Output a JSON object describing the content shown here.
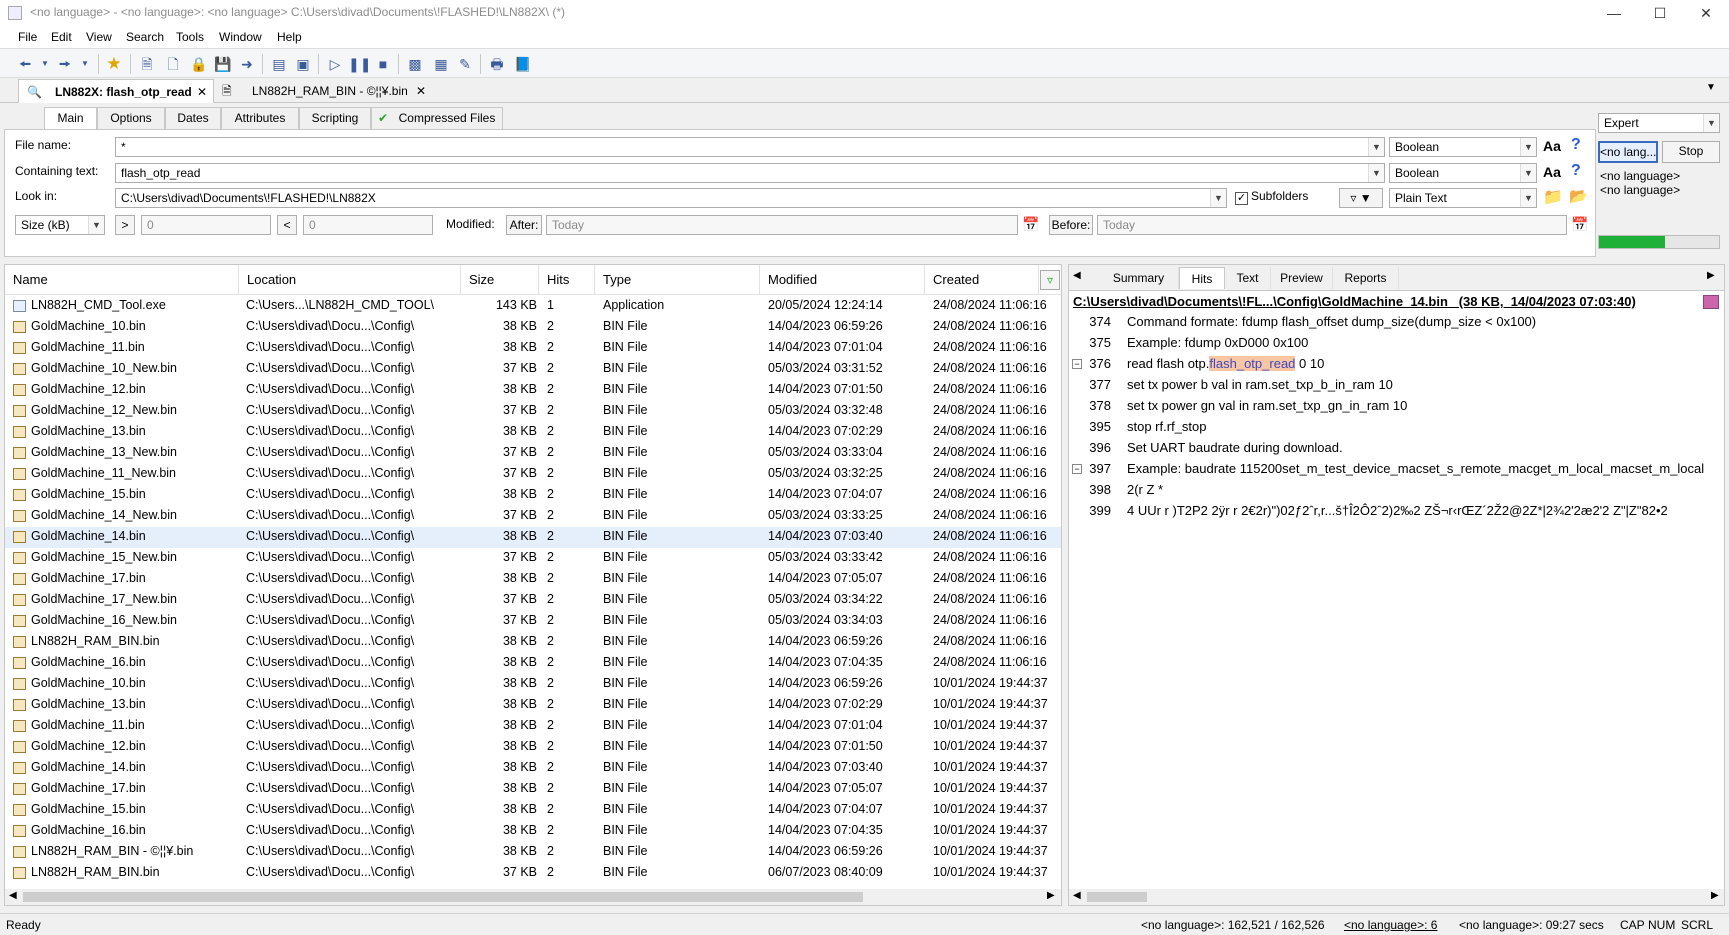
{
  "window": {
    "title": "<no language> - <no language>: <no language> C:\\Users\\divad\\Documents\\!FLASHED!\\LN882X\\ (*)"
  },
  "menu": [
    "File",
    "Edit",
    "View",
    "Search",
    "Tools",
    "Window",
    "Help"
  ],
  "doc_tabs": [
    {
      "label": "LN882X: flash_otp_read"
    },
    {
      "label": "LN882H_RAM_BIN - ©¦¦¥.bin"
    }
  ],
  "criteria_tabs": [
    "Main",
    "Options",
    "Dates",
    "Attributes",
    "Scripting",
    "Compressed Files"
  ],
  "criteria": {
    "file_name_label": "File name:",
    "file_name_value": "*",
    "file_name_mode": "Boolean",
    "containing_label": "Containing text:",
    "containing_value": "flash_otp_read",
    "containing_mode": "Boolean",
    "look_in_label": "Look in:",
    "look_in_value": "C:\\Users\\divad\\Documents\\!FLASHED!\\LN882X",
    "subfolders_label": "Subfolders",
    "text_type": "Plain Text",
    "size_unit": "Size (kB)",
    "gt_label": ">",
    "gt_value": "0",
    "lt_label": "<",
    "lt_value": "0",
    "modified_label": "Modified:",
    "after_label": "After:",
    "after_value": "Today",
    "before_label": "Before:",
    "before_value": "Today",
    "aa_label": "Aa",
    "help_label": "?"
  },
  "side_controls": {
    "mode": "Expert",
    "lang_button": "<no lang...",
    "stop_button": "Stop",
    "lang_line1": "<no language>",
    "lang_line2": "<no language>",
    "progress": 0.55
  },
  "list": {
    "columns": [
      "Name",
      "Location",
      "Size",
      "Hits",
      "Type",
      "Modified",
      "Created"
    ],
    "rows": [
      {
        "name": "LN882H_CMD_Tool.exe",
        "loc": "C:\\Users...\\LN882H_CMD_TOOL\\",
        "size": "143 KB",
        "hits": "1",
        "type": "Application",
        "mod": "20/05/2024 12:24:14",
        "cre": "24/08/2024 11:06:16"
      },
      {
        "name": "GoldMachine_10.bin",
        "loc": "C:\\Users\\divad\\Docu...\\Config\\",
        "size": "38 KB",
        "hits": "2",
        "type": "BIN File",
        "mod": "14/04/2023 06:59:26",
        "cre": "24/08/2024 11:06:16"
      },
      {
        "name": "GoldMachine_11.bin",
        "loc": "C:\\Users\\divad\\Docu...\\Config\\",
        "size": "38 KB",
        "hits": "2",
        "type": "BIN File",
        "mod": "14/04/2023 07:01:04",
        "cre": "24/08/2024 11:06:16"
      },
      {
        "name": "GoldMachine_10_New.bin",
        "loc": "C:\\Users\\divad\\Docu...\\Config\\",
        "size": "37 KB",
        "hits": "2",
        "type": "BIN File",
        "mod": "05/03/2024 03:31:52",
        "cre": "24/08/2024 11:06:16"
      },
      {
        "name": "GoldMachine_12.bin",
        "loc": "C:\\Users\\divad\\Docu...\\Config\\",
        "size": "38 KB",
        "hits": "2",
        "type": "BIN File",
        "mod": "14/04/2023 07:01:50",
        "cre": "24/08/2024 11:06:16"
      },
      {
        "name": "GoldMachine_12_New.bin",
        "loc": "C:\\Users\\divad\\Docu...\\Config\\",
        "size": "37 KB",
        "hits": "2",
        "type": "BIN File",
        "mod": "05/03/2024 03:32:48",
        "cre": "24/08/2024 11:06:16"
      },
      {
        "name": "GoldMachine_13.bin",
        "loc": "C:\\Users\\divad\\Docu...\\Config\\",
        "size": "38 KB",
        "hits": "2",
        "type": "BIN File",
        "mod": "14/04/2023 07:02:29",
        "cre": "24/08/2024 11:06:16"
      },
      {
        "name": "GoldMachine_13_New.bin",
        "loc": "C:\\Users\\divad\\Docu...\\Config\\",
        "size": "37 KB",
        "hits": "2",
        "type": "BIN File",
        "mod": "05/03/2024 03:33:04",
        "cre": "24/08/2024 11:06:16"
      },
      {
        "name": "GoldMachine_11_New.bin",
        "loc": "C:\\Users\\divad\\Docu...\\Config\\",
        "size": "37 KB",
        "hits": "2",
        "type": "BIN File",
        "mod": "05/03/2024 03:32:25",
        "cre": "24/08/2024 11:06:16"
      },
      {
        "name": "GoldMachine_15.bin",
        "loc": "C:\\Users\\divad\\Docu...\\Config\\",
        "size": "38 KB",
        "hits": "2",
        "type": "BIN File",
        "mod": "14/04/2023 07:04:07",
        "cre": "24/08/2024 11:06:16"
      },
      {
        "name": "GoldMachine_14_New.bin",
        "loc": "C:\\Users\\divad\\Docu...\\Config\\",
        "size": "37 KB",
        "hits": "2",
        "type": "BIN File",
        "mod": "05/03/2024 03:33:25",
        "cre": "24/08/2024 11:06:16"
      },
      {
        "name": "GoldMachine_14.bin",
        "loc": "C:\\Users\\divad\\Docu...\\Config\\",
        "size": "38 KB",
        "hits": "2",
        "type": "BIN File",
        "mod": "14/04/2023 07:03:40",
        "cre": "24/08/2024 11:06:16"
      },
      {
        "name": "GoldMachine_15_New.bin",
        "loc": "C:\\Users\\divad\\Docu...\\Config\\",
        "size": "37 KB",
        "hits": "2",
        "type": "BIN File",
        "mod": "05/03/2024 03:33:42",
        "cre": "24/08/2024 11:06:16"
      },
      {
        "name": "GoldMachine_17.bin",
        "loc": "C:\\Users\\divad\\Docu...\\Config\\",
        "size": "38 KB",
        "hits": "2",
        "type": "BIN File",
        "mod": "14/04/2023 07:05:07",
        "cre": "24/08/2024 11:06:16"
      },
      {
        "name": "GoldMachine_17_New.bin",
        "loc": "C:\\Users\\divad\\Docu...\\Config\\",
        "size": "37 KB",
        "hits": "2",
        "type": "BIN File",
        "mod": "05/03/2024 03:34:22",
        "cre": "24/08/2024 11:06:16"
      },
      {
        "name": "GoldMachine_16_New.bin",
        "loc": "C:\\Users\\divad\\Docu...\\Config\\",
        "size": "37 KB",
        "hits": "2",
        "type": "BIN File",
        "mod": "05/03/2024 03:34:03",
        "cre": "24/08/2024 11:06:16"
      },
      {
        "name": "LN882H_RAM_BIN.bin",
        "loc": "C:\\Users\\divad\\Docu...\\Config\\",
        "size": "38 KB",
        "hits": "2",
        "type": "BIN File",
        "mod": "14/04/2023 06:59:26",
        "cre": "24/08/2024 11:06:16"
      },
      {
        "name": "GoldMachine_16.bin",
        "loc": "C:\\Users\\divad\\Docu...\\Config\\",
        "size": "38 KB",
        "hits": "2",
        "type": "BIN File",
        "mod": "14/04/2023 07:04:35",
        "cre": "24/08/2024 11:06:16"
      },
      {
        "name": "GoldMachine_10.bin",
        "loc": "C:\\Users\\divad\\Docu...\\Config\\",
        "size": "38 KB",
        "hits": "2",
        "type": "BIN File",
        "mod": "14/04/2023 06:59:26",
        "cre": "10/01/2024 19:44:37"
      },
      {
        "name": "GoldMachine_13.bin",
        "loc": "C:\\Users\\divad\\Docu...\\Config\\",
        "size": "38 KB",
        "hits": "2",
        "type": "BIN File",
        "mod": "14/04/2023 07:02:29",
        "cre": "10/01/2024 19:44:37"
      },
      {
        "name": "GoldMachine_11.bin",
        "loc": "C:\\Users\\divad\\Docu...\\Config\\",
        "size": "38 KB",
        "hits": "2",
        "type": "BIN File",
        "mod": "14/04/2023 07:01:04",
        "cre": "10/01/2024 19:44:37"
      },
      {
        "name": "GoldMachine_12.bin",
        "loc": "C:\\Users\\divad\\Docu...\\Config\\",
        "size": "38 KB",
        "hits": "2",
        "type": "BIN File",
        "mod": "14/04/2023 07:01:50",
        "cre": "10/01/2024 19:44:37"
      },
      {
        "name": "GoldMachine_14.bin",
        "loc": "C:\\Users\\divad\\Docu...\\Config\\",
        "size": "38 KB",
        "hits": "2",
        "type": "BIN File",
        "mod": "14/04/2023 07:03:40",
        "cre": "10/01/2024 19:44:37"
      },
      {
        "name": "GoldMachine_17.bin",
        "loc": "C:\\Users\\divad\\Docu...\\Config\\",
        "size": "38 KB",
        "hits": "2",
        "type": "BIN File",
        "mod": "14/04/2023 07:05:07",
        "cre": "10/01/2024 19:44:37"
      },
      {
        "name": "GoldMachine_15.bin",
        "loc": "C:\\Users\\divad\\Docu...\\Config\\",
        "size": "38 KB",
        "hits": "2",
        "type": "BIN File",
        "mod": "14/04/2023 07:04:07",
        "cre": "10/01/2024 19:44:37"
      },
      {
        "name": "GoldMachine_16.bin",
        "loc": "C:\\Users\\divad\\Docu...\\Config\\",
        "size": "38 KB",
        "hits": "2",
        "type": "BIN File",
        "mod": "14/04/2023 07:04:35",
        "cre": "10/01/2024 19:44:37"
      },
      {
        "name": "LN882H_RAM_BIN - ©¦¦¥.bin",
        "loc": "C:\\Users\\divad\\Docu...\\Config\\",
        "size": "38 KB",
        "hits": "2",
        "type": "BIN File",
        "mod": "14/04/2023 06:59:26",
        "cre": "10/01/2024 19:44:37"
      },
      {
        "name": "LN882H_RAM_BIN.bin",
        "loc": "C:\\Users\\divad\\Docu...\\Config\\",
        "size": "37 KB",
        "hits": "2",
        "type": "BIN File",
        "mod": "06/07/2023 08:40:09",
        "cre": "10/01/2024 19:44:37"
      }
    ]
  },
  "right": {
    "tabs": [
      "Summary",
      "Hits",
      "Text",
      "Preview",
      "Reports"
    ],
    "active_tab": "Hits",
    "file_header": "C:\\Users\\divad\\Documents\\!FL...\\Config\\GoldMachine_14.bin   (38 KB,  14/04/2023 07:03:40)",
    "hits": [
      {
        "num": "374",
        "text": "Command formate: fdump flash_offset dump_size(dump_size < 0x100)"
      },
      {
        "num": "375",
        "text": " Example: fdump 0xD000 0x100"
      },
      {
        "num": "376",
        "pre": "read flash otp.",
        "hl": "flash_otp_read",
        "post": " 0 10"
      },
      {
        "num": "377",
        "text": "set tx power b val in ram.set_txp_b_in_ram 10"
      },
      {
        "num": "378",
        "text": "set tx power gn val in ram.set_txp_gn_in_ram 10"
      },
      {
        "num": "395",
        "text": "stop rf.rf_stop"
      },
      {
        "num": "396",
        "text": "Set UART baudrate during download."
      },
      {
        "num": "397",
        "text": "Example: baudrate 115200set_m_test_device_macset_s_remote_macget_m_local_macset_m_local"
      },
      {
        "num": "398",
        "text": "2(r Z *"
      },
      {
        "num": "399",
        "text": "4 UUr r )T2P2 2ÿr r 2€2r)\")02ƒ2ˆr,r...š†Î2Ô2ˆ2)2‰2 ZŠ¬r‹rŒZ´2Ž2@2Z*|2¾2'2æ2'2 Z\"|Z\"82•2"
      }
    ]
  },
  "status": {
    "ready": "Ready",
    "count": "<no language>: 162,521 / 162,526",
    "lang_link": "<no language>: 6",
    "time": "<no language>: 09:27 secs",
    "caps": "CAP",
    "num": "NUM",
    "scrl": "SCRL"
  },
  "colors": {
    "progress_fill": "#1fb03a",
    "highlight_bg": "#f9c6a3",
    "highlight_fg": "#3d48c4",
    "selected_row": "#e5eefb"
  }
}
